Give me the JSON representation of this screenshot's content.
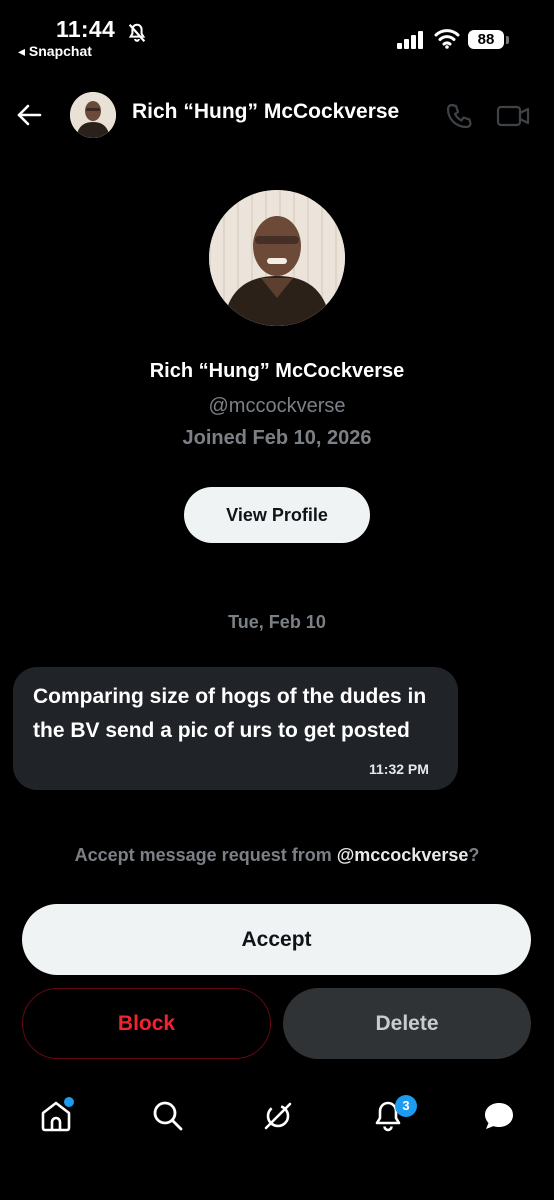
{
  "status_bar": {
    "time": "11:44",
    "back_app": "◂ Snapchat",
    "battery": "88"
  },
  "header": {
    "name": "Rich “Hung” McCockverse"
  },
  "profile": {
    "name": "Rich “Hung” McCockverse",
    "handle": "@mccockverse",
    "joined": "Joined Feb 10, 2026",
    "view_profile_label": "View Profile"
  },
  "conversation": {
    "date_separator": "Tue, Feb 10",
    "messages": [
      {
        "text": "Comparing size of hogs of the dudes in the BV send a pic of urs to get posted",
        "time": "11:32 PM"
      }
    ]
  },
  "request": {
    "prompt_prefix": "Accept message request from ",
    "prompt_handle": "@mccockverse",
    "prompt_suffix": "?",
    "accept_label": "Accept",
    "block_label": "Block",
    "delete_label": "Delete"
  },
  "nav": {
    "notifications_badge": "3",
    "icons": [
      "home-icon",
      "search-icon",
      "grok-icon",
      "bell-icon",
      "messages-icon"
    ]
  },
  "colors": {
    "background": "#000000",
    "accent": "#1d9bf0",
    "danger": "#f4212e",
    "muted_text": "#7b8086",
    "bubble": "#202327"
  }
}
